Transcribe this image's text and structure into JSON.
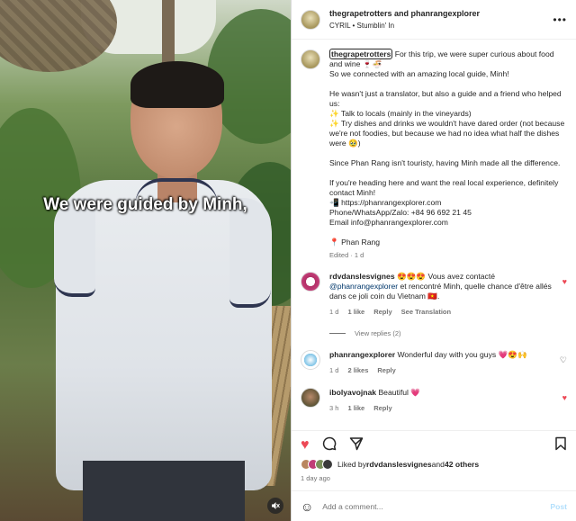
{
  "media": {
    "caption_overlay": "We were guided by Minh,",
    "mute_icon": "speaker-muted-icon"
  },
  "header": {
    "authors": "thegrapetrotters and phanrangexplorer",
    "audio": "CYRIL • Stumblin' In",
    "more": "•••"
  },
  "caption": {
    "username": "thegrapetrotters",
    "text": " For this trip, we were super curious about food and wine 🍷🍜\nSo we connected with an amazing local guide, Minh!\n\nHe wasn't just a translator, but also a guide and a friend who helped us:\n✨ Talk to locals (mainly in the vineyards)\n✨ Try dishes and drinks we wouldn't have dared order (not because we're not foodies, but because we had no idea what half the dishes were 🥹)\n\nSince Phan Rang isn't touristy, having Minh made all the difference.\n\nIf you're heading here and want the real local experience, definitely contact Minh!\n📲 https://phanrangexplorer.com\nPhone/WhatsApp/Zalo: +84 96 692 21 45\nEmail info@phanrangexplorer.com\n\n📍 Phan Rang",
    "edited": "Edited · 1 d"
  },
  "comments": [
    {
      "user": "rdvdanslesvignes",
      "pre": " 😍😍😍 Vous avez contacté ",
      "mention": "@phanrangexplorer",
      "post": " et rencontré Minh, quelle chance d'être allés dans ce joli coin du Vietnam 🇻🇳.",
      "time": "1 d",
      "likes": "1 like",
      "reply": "Reply",
      "translation": "See Translation",
      "liked": true
    },
    {
      "user": "phanrangexplorer",
      "pre": " Wonderful day with you guys 💗😍🙌",
      "mention": "",
      "post": "",
      "time": "1 d",
      "likes": "2 likes",
      "reply": "Reply",
      "liked": false
    },
    {
      "user": "ibolyavojnak",
      "pre": " Beautiful 💗",
      "mention": "",
      "post": "",
      "time": "3 h",
      "likes": "1 like",
      "reply": "Reply",
      "liked": true
    }
  ],
  "view_replies": "View replies (2)",
  "actions": {
    "like_icon": "heart-filled-icon",
    "comment_icon": "comment-icon",
    "share_icon": "send-icon",
    "save_icon": "bookmark-icon"
  },
  "likes": {
    "prefix": "Liked by ",
    "user": "rdvdanslesvignes",
    "middle": " and ",
    "others": "42 others"
  },
  "posted": "1 day ago",
  "add_comment": {
    "placeholder": "Add a comment...",
    "post_label": "Post"
  },
  "colors": {
    "like_red": "#ed4956",
    "link_blue": "#00376b",
    "post_disabled": "#b2dffc"
  }
}
